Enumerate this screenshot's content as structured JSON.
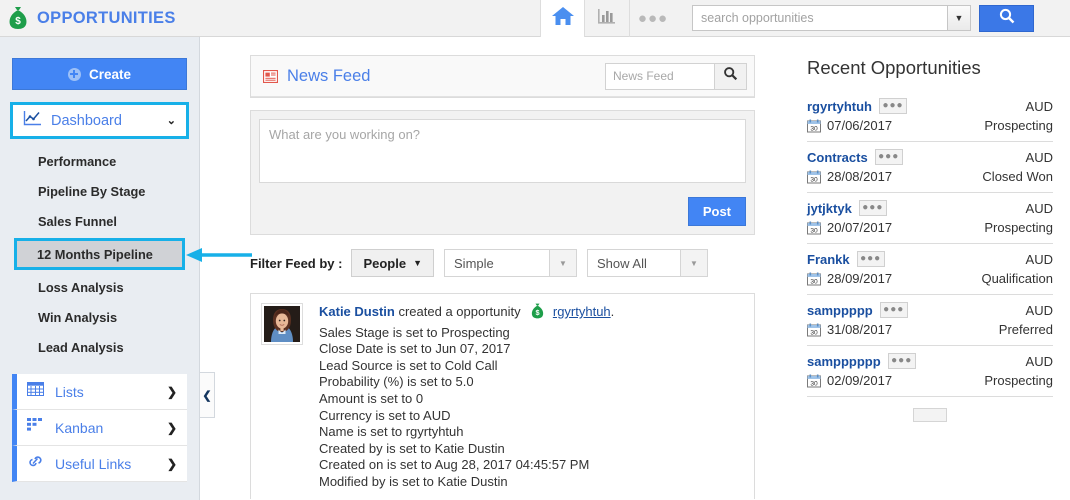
{
  "topbar": {
    "brand_title": "OPPORTUNITIES",
    "brand_icon": "money-bag-icon",
    "home_icon": "home-icon",
    "chart_icon": "bar-chart-icon",
    "more_icon": "ellipsis-icon",
    "more_glyph": "●●●",
    "search_placeholder": "search opportunities",
    "search_value": "",
    "search_caret": "▼",
    "search_button_icon": "search-icon"
  },
  "sidebar": {
    "create_label": "Create",
    "create_icon": "plus-circle-icon",
    "dashboard": {
      "label": "Dashboard",
      "icon": "line-chart-icon",
      "chevron": "⌄",
      "highlighted": true
    },
    "sub_items": [
      {
        "label": "Performance",
        "selected": false
      },
      {
        "label": "Pipeline By Stage",
        "selected": false
      },
      {
        "label": "Sales Funnel",
        "selected": false
      },
      {
        "label": "12 Months Pipeline",
        "selected": true
      },
      {
        "label": "Loss Analysis",
        "selected": false
      },
      {
        "label": "Win Analysis",
        "selected": false
      },
      {
        "label": "Lead Analysis",
        "selected": false
      }
    ],
    "cards": [
      {
        "label": "Lists",
        "icon": "grid-table-icon",
        "chevron": "❯"
      },
      {
        "label": "Kanban",
        "icon": "kanban-board-icon",
        "chevron": "❯"
      },
      {
        "label": "Useful Links",
        "icon": "link-chain-icon",
        "chevron": "❯"
      }
    ],
    "collapse_chevron": "❮"
  },
  "feed": {
    "title": "News Feed",
    "title_icon": "newspaper-icon",
    "search_placeholder": "News Feed",
    "search_value": "",
    "search_button_icon": "search-icon",
    "composer_placeholder": "What are you working on?",
    "composer_value": "",
    "post_label": "Post",
    "filter_label": "Filter Feed by :",
    "filter_people": "People",
    "filter_people_caret": "▼",
    "filter_mode": "Simple",
    "filter_scope": "Show All",
    "select_arrow": "▼",
    "post": {
      "avatar": "user-avatar",
      "author": "Katie Dustin",
      "action": "created a opportunity",
      "record_icon": "money-bag-icon",
      "record_link": "rgyrtyhtuh",
      "period": ".",
      "detail_lines": [
        "Sales Stage is set to Prospecting",
        "Close Date is set to Jun 07, 2017",
        "Lead Source is set to Cold Call",
        "Probability (%) is set to 5.0",
        "Amount is set to 0",
        "Currency is set to AUD",
        "Name is set to rgyrtyhtuh",
        "Created by is set to Katie Dustin",
        "Created on is set to Aug 28, 2017 04:45:57 PM",
        "Modified by is set to Katie Dustin"
      ]
    }
  },
  "recent": {
    "title": "Recent Opportunities",
    "dots_glyph": "●●●",
    "calendar_icon": "calendar-icon",
    "calendar_day": "30",
    "items": [
      {
        "name": "rgyrtyhtuh",
        "date": "07/06/2017",
        "currency": "AUD",
        "stage": "Prospecting"
      },
      {
        "name": "Contracts",
        "date": "28/08/2017",
        "currency": "AUD",
        "stage": "Closed Won"
      },
      {
        "name": "jytjktyk",
        "date": "20/07/2017",
        "currency": "AUD",
        "stage": "Prospecting"
      },
      {
        "name": "Frankk",
        "date": "28/09/2017",
        "currency": "AUD",
        "stage": "Qualification"
      },
      {
        "name": "samppppp",
        "date": "31/08/2017",
        "currency": "AUD",
        "stage": "Preferred"
      },
      {
        "name": "sampppppp",
        "date": "02/09/2017",
        "currency": "AUD",
        "stage": "Prospecting"
      }
    ]
  },
  "annotation": {
    "arrow_color": "#17b0e8",
    "highlight_color": "#17b0e8",
    "points_to": "12 Months Pipeline"
  },
  "colors": {
    "brand_blue": "#4a7fe8",
    "accent_blue": "#4285f4",
    "money_green": "#1e9e4a",
    "highlight_cyan": "#17b0e8",
    "sidebar_bg": "#e9edf2"
  }
}
